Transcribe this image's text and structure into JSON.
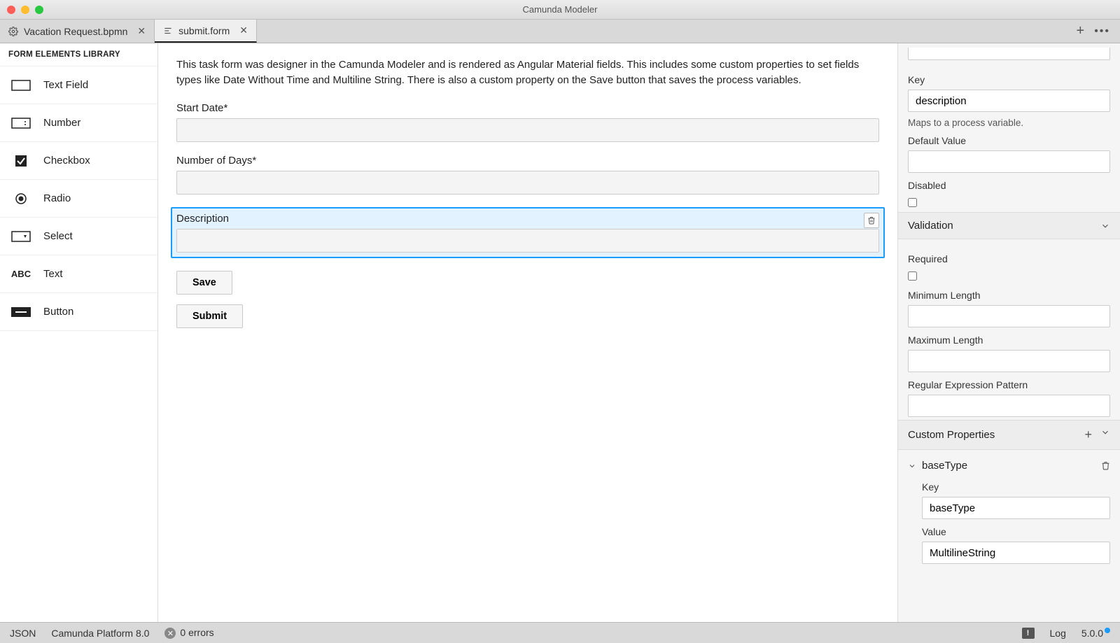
{
  "title": "Camunda Modeler",
  "tabs": [
    {
      "label": "Vacation Request.bpmn",
      "active": false,
      "icon": "gear-icon"
    },
    {
      "label": "submit.form",
      "active": true,
      "icon": "form-icon"
    }
  ],
  "palette": {
    "header": "FORM ELEMENTS LIBRARY",
    "items": [
      {
        "label": "Text Field",
        "icon": "textfield-icon"
      },
      {
        "label": "Number",
        "icon": "number-icon"
      },
      {
        "label": "Checkbox",
        "icon": "checkbox-icon"
      },
      {
        "label": "Radio",
        "icon": "radio-icon"
      },
      {
        "label": "Select",
        "icon": "select-icon"
      },
      {
        "label": "Text",
        "icon": "text-icon"
      },
      {
        "label": "Button",
        "icon": "button-icon"
      }
    ]
  },
  "canvas": {
    "intro": "This task form was designer in the Camunda Modeler and is rendered as Angular Material fields. This includes some custom properties to set fields types like Date Without Time and Multiline String. There is also a custom property on the Save button that saves the process variables.",
    "fields": [
      {
        "label": "Start Date*"
      },
      {
        "label": "Number of Days*"
      },
      {
        "label": "Description",
        "selected": true
      }
    ],
    "buttons": [
      {
        "label": "Save"
      },
      {
        "label": "Submit"
      }
    ]
  },
  "props": {
    "key": {
      "label": "Key",
      "value": "description",
      "hint": "Maps to a process variable."
    },
    "defaultValue": {
      "label": "Default Value",
      "value": ""
    },
    "disabled": {
      "label": "Disabled",
      "checked": false
    },
    "validation": {
      "header": "Validation",
      "required": {
        "label": "Required",
        "checked": false
      },
      "minLength": {
        "label": "Minimum Length",
        "value": ""
      },
      "maxLength": {
        "label": "Maximum Length",
        "value": ""
      },
      "pattern": {
        "label": "Regular Expression Pattern",
        "value": ""
      }
    },
    "custom": {
      "header": "Custom Properties",
      "items": [
        {
          "name": "baseType",
          "key": {
            "label": "Key",
            "value": "baseType"
          },
          "value": {
            "label": "Value",
            "value": "MultilineString"
          }
        }
      ]
    }
  },
  "status": {
    "format": "JSON",
    "platform": "Camunda Platform 8.0",
    "errors": "0 errors",
    "log": "Log",
    "version": "5.0.0"
  }
}
